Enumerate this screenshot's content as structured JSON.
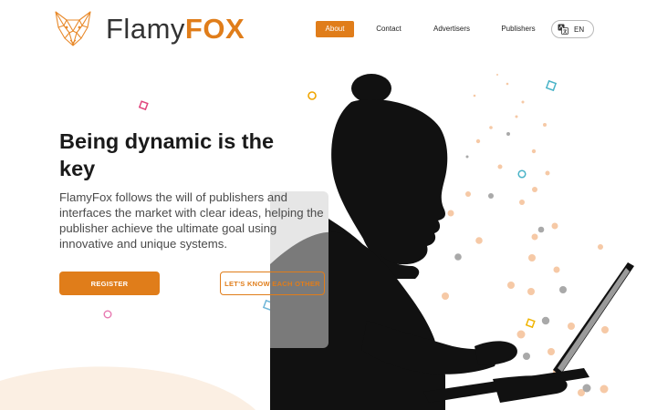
{
  "header": {
    "brand_part1": "Flamy",
    "brand_part2": "FOX",
    "nav": [
      {
        "label": "About",
        "active": true
      },
      {
        "label": "Contact",
        "active": false
      },
      {
        "label": "Advertisers",
        "active": false
      },
      {
        "label": "Publishers",
        "active": false
      }
    ],
    "language": {
      "label": "EN",
      "icon": "translate-icon"
    }
  },
  "hero": {
    "headline": "Being dynamic is the key",
    "subtext": "FlamyFox follows the will of publishers and interfaces the market with clear ideas, helping the publisher achieve the ultimate goal using innovative and unique systems.",
    "register_label": "REGISTER",
    "know_label": "LET'S KNOW EACH OTHER"
  },
  "colors": {
    "accent": "#e07d1a",
    "text_dark": "#1a1a1a",
    "text_body": "#4a4a4a",
    "silhouette": "#111111"
  }
}
